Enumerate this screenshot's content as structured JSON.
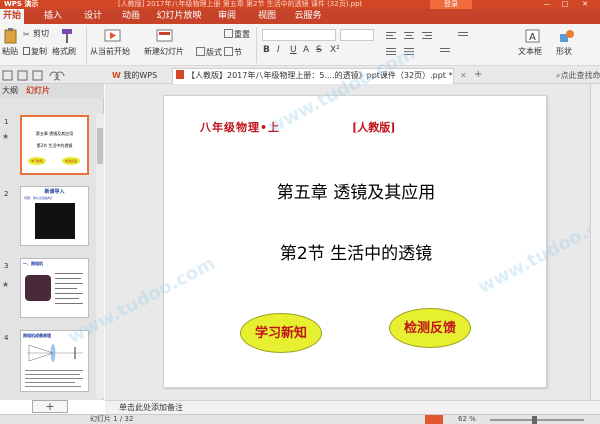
{
  "window": {
    "app_name": "WPS 演示",
    "doc_title": "[人教版] 2017年八年级物理上册 第五章 第2节 生活中的透镜 课件 (32页).ppt",
    "login": "登录",
    "minimize": "—",
    "maximize": "□",
    "close": "✕"
  },
  "menu": {
    "tabs": [
      "开始",
      "插入",
      "设计",
      "动画",
      "幻灯片放映",
      "审阅",
      "视图",
      "云服务"
    ]
  },
  "ribbon": {
    "paste": "粘贴",
    "cut": "剪切",
    "copy": "复制",
    "format_painter": "格式刷",
    "from_current": "从当前开始",
    "new_slide": "新建幻灯片",
    "layout": "版式",
    "section": "节",
    "reset": "重置",
    "textbox": "文本框",
    "shape": "形状",
    "font_name": "",
    "font_size": "",
    "bold": "B",
    "italic": "I",
    "underline": "U",
    "strike": "S",
    "shadow": "A",
    "super_sub": "X²"
  },
  "tabbar": {
    "my_wps": "我的WPS",
    "doc_tab": "【人教版】2017年八年级物理上册：5....的透镜》ppt课件（32页）.ppt *",
    "tab_close": "✕",
    "add_tab": "+",
    "search_hint": "点此查找命令"
  },
  "left_pane": {
    "tab_outline": "大纲",
    "tab_slides": "幻灯片",
    "slide_numbers": [
      "1",
      "2",
      "3",
      "4"
    ],
    "star": "★",
    "add_slide": "+",
    "thumb1": {
      "line1": "第五章  透镜及其应用",
      "line2": "第2节  生活中的透镜",
      "oval1": "学习新知",
      "oval2": "检测反馈"
    },
    "thumb2_title": "新课导入",
    "thumb2_sub": "问题：你认识这些吗？",
    "thumb3_title": "一、照相机",
    "thumb4_title": "照相机成像原理"
  },
  "slide": {
    "grade": "八年级物理•上",
    "edition": "[人教版]",
    "chapter": "第五章   透镜及其应用",
    "section": "第2节   生活中的透镜",
    "btn_learn": "学习新知",
    "btn_check": "检测反馈"
  },
  "notes": {
    "placeholder": "单击此处添加备注"
  },
  "status": {
    "page": "幻灯片 1 / 32",
    "zoom": "62 %"
  },
  "colors": {
    "accent": "#d24726",
    "slide_title_red": "#c0141c",
    "oval_fill": "#e6ef30"
  },
  "watermark": "www.tudoo.com"
}
